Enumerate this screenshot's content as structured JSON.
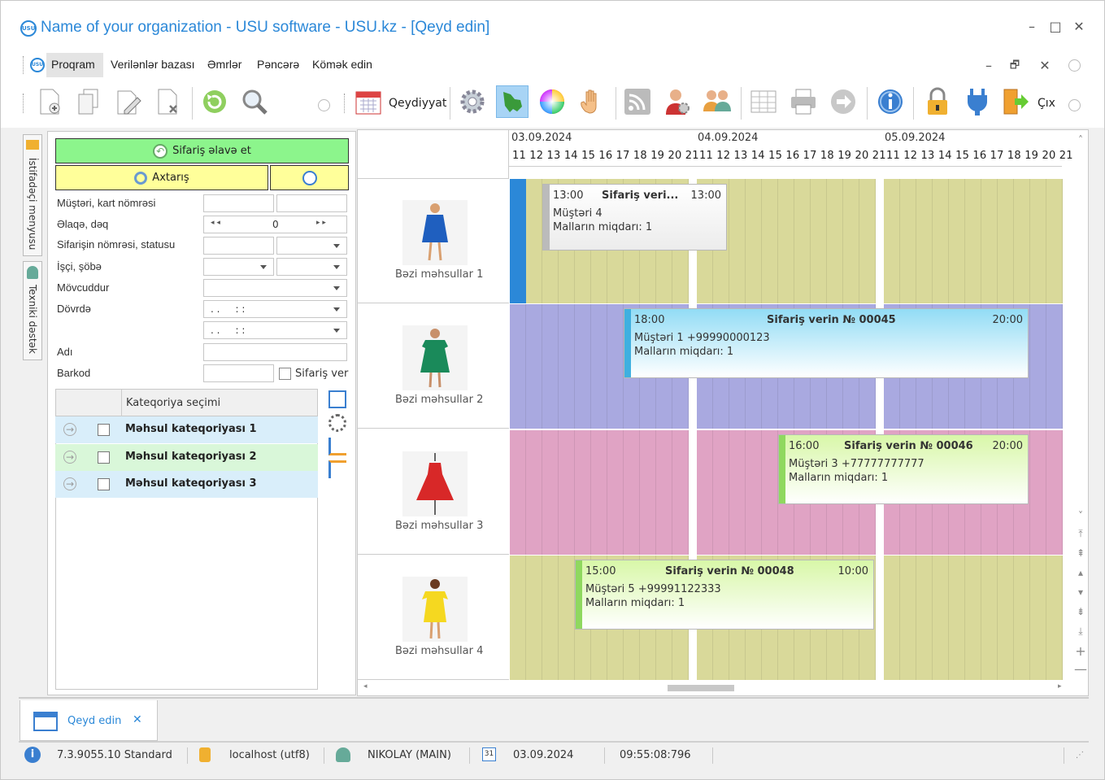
{
  "window": {
    "title": "Name of your organization - USU software - USU.kz - [Qeyd edin]",
    "min": "–",
    "max": "□",
    "close": "✕"
  },
  "menu": {
    "items": [
      "Proqram",
      "Verilənlər bazası",
      "Əmrlər",
      "Pəncərə",
      "Kömək edin"
    ],
    "mdi_min": "–",
    "mdi_restore": "🗗",
    "mdi_close": "✕"
  },
  "toolbar": {
    "qeydiyyat": "Qeydiyyat",
    "exit": "Çıx"
  },
  "lefttabs": {
    "user_menu": "İstifadəçi menyusu",
    "tech_support": "Texniki dəstək"
  },
  "panel": {
    "add_order": "Sifariş əlavə et",
    "search": "Axtarış",
    "fields": {
      "customer": "Müştəri, kart nömrəsi",
      "contact": "Əlaqə, dəq",
      "order_no": "Sifarişin nömrəsi, statusu",
      "worker": "İşçi, şöbə",
      "available": "Mövcuddur",
      "period": "Dövrdə",
      "name": "Adı",
      "barcode": "Barkod"
    },
    "contact_value": "0",
    "date1": ". .     : :",
    "date2": ". .     : :",
    "order_checkbox": "Sifariş verı",
    "cat_header": "Kateqoriya seçimi",
    "categories": [
      {
        "label": "Məhsul kateqoriyası 1",
        "color": "#d9eefa"
      },
      {
        "label": "Məhsul kateqoriyası 2",
        "color": "#d9f7d9"
      },
      {
        "label": "Məhsul kateqoriyası 3",
        "color": "#d9eefa"
      }
    ]
  },
  "schedule": {
    "days": [
      "03.09.2024",
      "04.09.2024",
      "05.09.2024"
    ],
    "hours": "11 12 13 14 15 16 17 18 19 20 21",
    "products": [
      "Bəzi məhsullar 1",
      "Bəzi məhsullar 2",
      "Bəzi məhsullar 3",
      "Bəzi məhsullar 4"
    ],
    "lane_colors": [
      "#d9d99a",
      "#a9a9e0",
      "#e0a3c4",
      "#d9d99a"
    ],
    "cards": [
      {
        "start": "13:00",
        "title": "Sifariş veri...",
        "end": "13:00",
        "line1": "Müştəri 4",
        "line2": "Malların miqdarı: 1"
      },
      {
        "start": "18:00",
        "title": "Sifariş verin № 00045",
        "end": "20:00",
        "line1": "Müştəri 1 +99990000123",
        "line2": "Malların miqdarı: 1"
      },
      {
        "start": "16:00",
        "title": "Sifariş verin № 00046",
        "end": "20:00",
        "line1": "Müştəri 3 +77777777777",
        "line2": "Malların miqdarı: 1"
      },
      {
        "start": "15:00",
        "title": "Sifariş verin № 00048",
        "end": "10:00",
        "line1": "Müştəri 5 +99991122333",
        "line2": "Malların miqdarı: 1"
      }
    ]
  },
  "doctab": {
    "label": "Qeyd edin",
    "close": "✕"
  },
  "status": {
    "version": "7.3.9055.10 Standard",
    "db": "localhost (utf8)",
    "user": "NIKOLAY (MAIN)",
    "date": "03.09.2024",
    "time": "09:55:08:796"
  }
}
